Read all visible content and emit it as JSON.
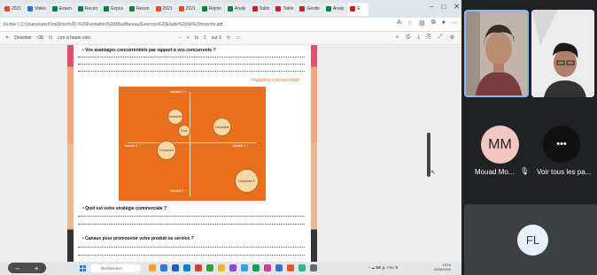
{
  "browser": {
    "tabs": [
      {
        "label": "2021",
        "color": "#e34c26"
      },
      {
        "label": "Vidéo",
        "color": "#1a73e8"
      },
      {
        "label": "Essen",
        "color": "#0b8043"
      },
      {
        "label": "Recon",
        "color": "#0b8043"
      },
      {
        "label": "Expos",
        "color": "#0b8043"
      },
      {
        "label": "Recon",
        "color": "#0b8043"
      },
      {
        "label": "2021",
        "color": "#e34c26"
      },
      {
        "label": "2021",
        "color": "#e34c26"
      },
      {
        "label": "Rejoin",
        "color": "#0b8043"
      },
      {
        "label": "Analy",
        "color": "#0b8043"
      },
      {
        "label": "Tablo",
        "color": "#c5221f"
      },
      {
        "label": "Tablo",
        "color": "#c5221f"
      },
      {
        "label": "Gestio",
        "color": "#c5221f"
      },
      {
        "label": "Analy",
        "color": "#0b8043"
      },
      {
        "label": "É",
        "color": "#c5221f",
        "active": true
      }
    ],
    "address": "Fichier  |  C:/Users/user/OneDrive%20-%20Fondation%20Mba/Bureau/Exercice%20Etude%20de%20marché.pdf",
    "pdf_toolbar": {
      "draw": "Dessiner",
      "read_aloud": "Lire à haute voix",
      "zoom_minus": "−",
      "zoom_plus": "+",
      "page_current": "2",
      "page_total": "sur 3"
    }
  },
  "document": {
    "q1": "Vos avantages concurrentiels par rapport à vos concurrents ?",
    "chart_title": "mapping concurrentiel",
    "q2": "Quel est votre stratégie commerciale ?",
    "q3": "Canaux pour promouvoir votre produit ou service ?",
    "axes": {
      "top": "Variable 2 +",
      "bottom": "Variable 2 −",
      "left": "Variable 1 −",
      "right": "Variable 1 +"
    },
    "bubbles": [
      "Concurrent",
      "Conc.",
      "Concurrent",
      "Concurrent",
      "Concurrent X"
    ],
    "side_colors": {
      "top": "#e0506b",
      "mid": "#f2a77a",
      "low": "#e9b894",
      "bottom": "#333333"
    }
  },
  "taskbar": {
    "search": "Rechercher",
    "tray": "FRA",
    "time": "19:18",
    "date": "20/06/2023"
  },
  "meet": {
    "participant_mm": {
      "initials": "MM",
      "name": "Mouad Mo..."
    },
    "more": {
      "label": "Voir tous les pa..."
    },
    "participant_fl": {
      "initials": "FL"
    }
  }
}
